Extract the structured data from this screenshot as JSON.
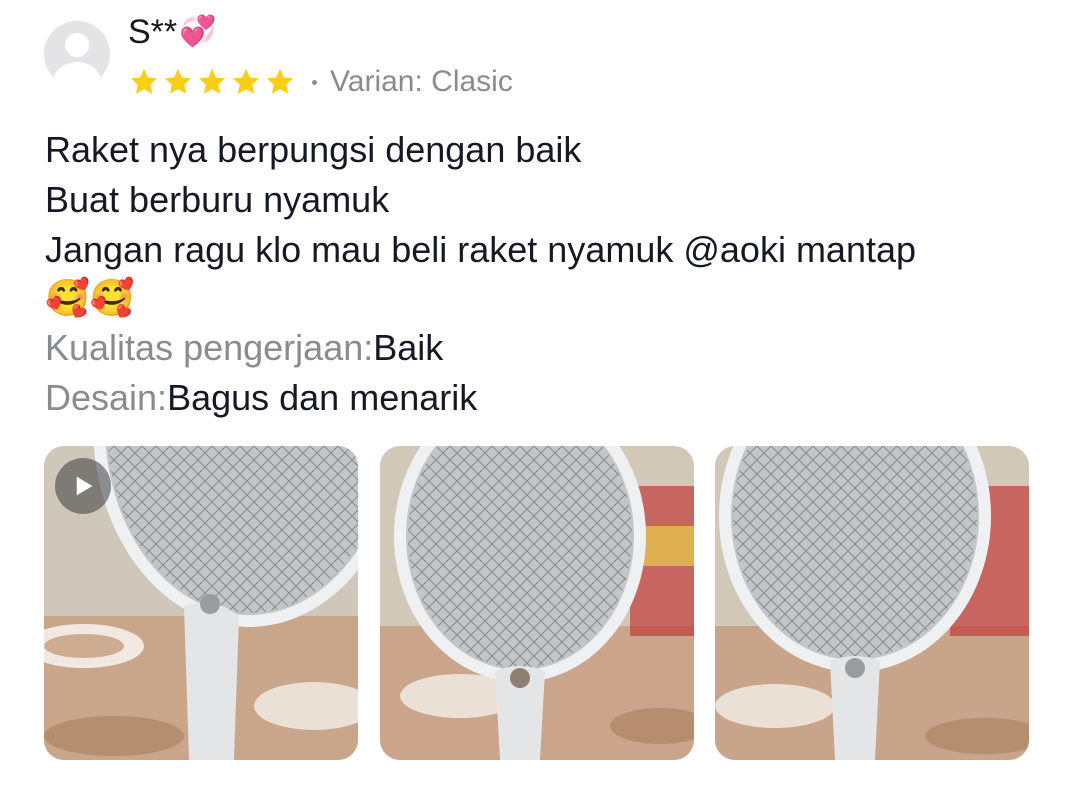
{
  "review": {
    "username": "S**",
    "username_emoji": "💞",
    "rating": 5,
    "rating_max": 5,
    "star_color": "#FACE15",
    "variant_label": "Varian: Clasic",
    "text_lines": [
      "Raket nya berpungsi dengan baik",
      "Buat berburu nyamuk",
      "Jangan ragu klo mau beli raket nyamuk @aoki mantap"
    ],
    "emoji_line": "🥰🥰",
    "attributes": [
      {
        "key": "Kualitas pengerjaan:",
        "value": "Baik"
      },
      {
        "key": "Desain:",
        "value": "Bagus dan menarik"
      }
    ],
    "media": [
      {
        "type": "video",
        "icon": "play-icon",
        "subject": "mosquito-racket-photo"
      },
      {
        "type": "image",
        "subject": "mosquito-racket-photo"
      },
      {
        "type": "image",
        "subject": "mosquito-racket-photo"
      }
    ]
  }
}
